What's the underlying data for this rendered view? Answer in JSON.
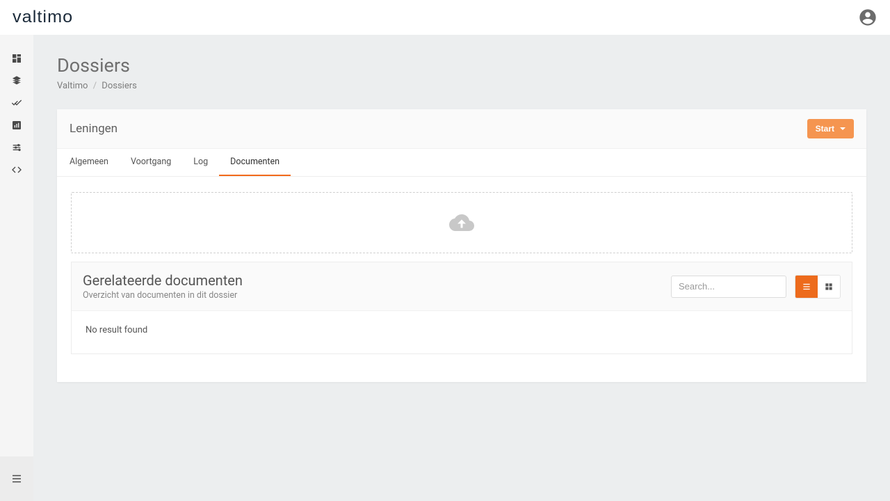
{
  "brand": "valtimo",
  "page": {
    "title": "Dossiers",
    "breadcrumb_root": "Valtimo",
    "breadcrumb_sep": "/",
    "breadcrumb_current": "Dossiers"
  },
  "dossier": {
    "name": "Leningen",
    "start_label": "Start"
  },
  "tabs": [
    {
      "id": "algemeen",
      "label": "Algemeen"
    },
    {
      "id": "voortgang",
      "label": "Voortgang"
    },
    {
      "id": "log",
      "label": "Log"
    },
    {
      "id": "documenten",
      "label": "Documenten"
    }
  ],
  "docs": {
    "title": "Gerelateerde documenten",
    "subtitle": "Overzicht van documenten in dit dossier",
    "search_placeholder": "Search...",
    "no_result": "No result found"
  }
}
